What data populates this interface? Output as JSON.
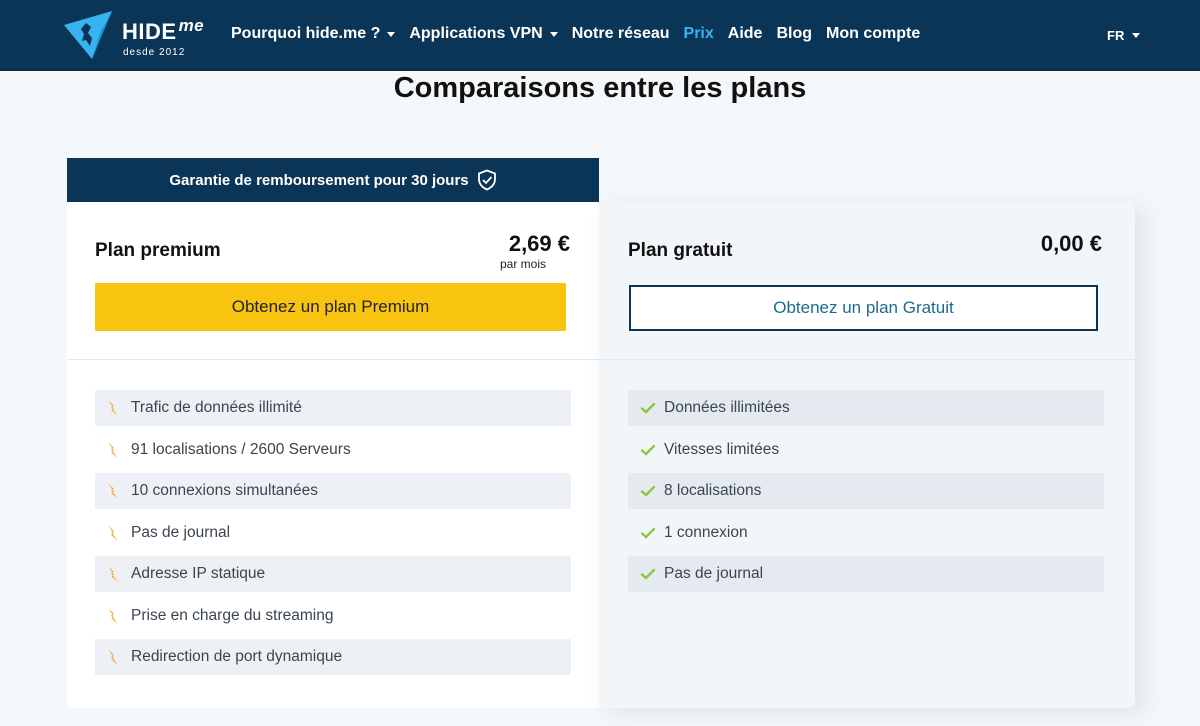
{
  "header": {
    "logo_text": "HIDE",
    "logo_me": "me",
    "logo_sub": "desde 2012",
    "nav": [
      {
        "label": "Pourquoi hide.me ?",
        "dropdown": true,
        "active": false
      },
      {
        "label": "Applications VPN",
        "dropdown": true,
        "active": false
      },
      {
        "label": "Notre réseau",
        "dropdown": false,
        "active": false
      },
      {
        "label": "Prix",
        "dropdown": false,
        "active": true
      },
      {
        "label": "Aide",
        "dropdown": false,
        "active": false
      },
      {
        "label": "Blog",
        "dropdown": false,
        "active": false
      },
      {
        "label": "Mon compte",
        "dropdown": false,
        "active": false
      }
    ],
    "language": "FR"
  },
  "page_title": "Comparaisons entre les plans",
  "guarantee": "Garantie de remboursement pour 30 jours",
  "premium": {
    "name": "Plan premium",
    "price": "2,69 €",
    "per": "par mois",
    "button": "Obtenez un plan Premium",
    "features": [
      "Trafic de données illimité",
      "91 localisations / 2600 Serveurs",
      "10 connexions simultanées",
      "Pas de journal",
      "Adresse IP statique",
      "Prise en charge du streaming",
      "Redirection de port dynamique"
    ]
  },
  "free": {
    "name": "Plan gratuit",
    "price": "0,00 €",
    "button": "Obtenez un plan Gratuit",
    "features": [
      "Données illimitées",
      "Vitesses limitées",
      "8 localisations",
      "1 connexion",
      "Pas de journal"
    ]
  },
  "colors": {
    "navy": "#0b3557",
    "accent_blue": "#39b3ef",
    "yellow": "#f8c40f",
    "bolt_orange": "#f0a830",
    "check_green": "#8cc63f"
  },
  "icons": {
    "premium_feature": "lightning-bolt-icon",
    "free_feature": "checkmark-icon",
    "guarantee": "shield-check-icon"
  }
}
